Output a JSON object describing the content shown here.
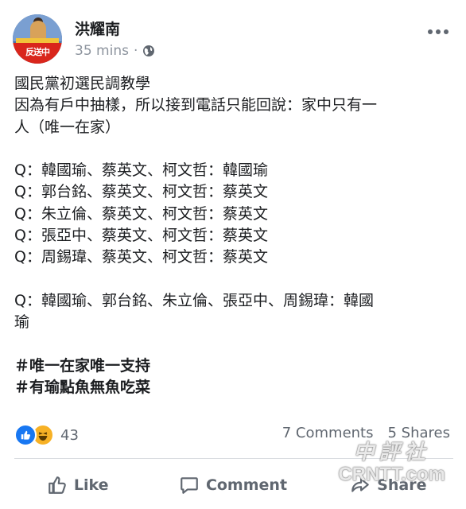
{
  "post": {
    "author": "洪耀南",
    "time": "35 mins",
    "separator": "·",
    "privacy_icon": "globe-icon",
    "avatar_text": "反送中",
    "lines": [
      "國民黨初選民調教學",
      "因為有戶中抽樣，所以接到電話只能回說：家中只有一",
      "人（唯一在家）",
      "",
      "Q：韓國瑜、蔡英文、柯文哲：韓國瑜",
      "Q：郭台銘、蔡英文、柯文哲：蔡英文",
      "Q：朱立倫、蔡英文、柯文哲：蔡英文",
      "Q：張亞中、蔡英文、柯文哲：蔡英文",
      "Q：周錫瑋、蔡英文、柯文哲：蔡英文",
      "",
      "Q：韓國瑜、郭台銘、朱立倫、張亞中、周錫瑋：韓國",
      "瑜",
      "",
      "＃唯一在家唯一支持",
      "＃有瑜點魚無魚吃菜"
    ]
  },
  "engagement": {
    "reaction_count": "43",
    "reaction_icons": [
      "like-icon",
      "haha-icon"
    ],
    "comments": "7 Comments",
    "shares": "5 Shares"
  },
  "actions": {
    "like": "Like",
    "comment": "Comment",
    "share": "Share"
  },
  "watermark": {
    "cn": "中評社",
    "en": "CRNTT.com"
  },
  "colors": {
    "text": "#1c1e21",
    "muted": "#606770",
    "meta": "#8d949e",
    "like_blue": "#1877f2",
    "haha_yellow": "#f7b125"
  }
}
